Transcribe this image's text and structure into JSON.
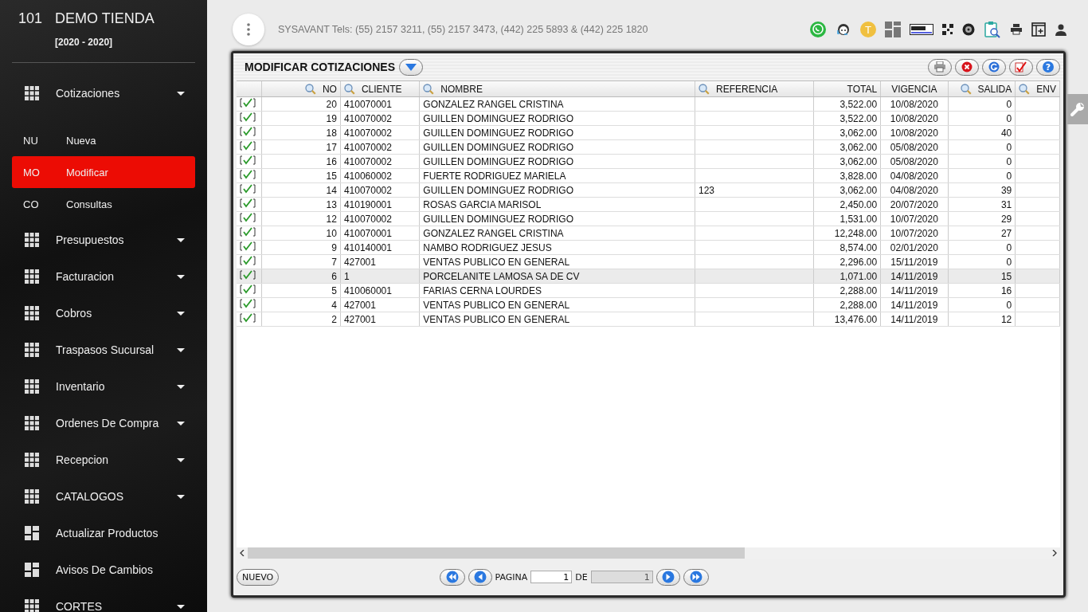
{
  "sidebar": {
    "store_number": "101",
    "store_name": "DEMO TIENDA",
    "period": "[2020 - 2020]",
    "items": [
      {
        "kind": "menu",
        "label": "Cotizaciones",
        "children": [
          {
            "abbr": "NU",
            "label": "Nueva",
            "selected": false
          },
          {
            "abbr": "MO",
            "label": "Modificar",
            "selected": true
          },
          {
            "abbr": "CO",
            "label": "Consultas",
            "selected": false
          }
        ]
      },
      {
        "kind": "menu",
        "label": "Presupuestos"
      },
      {
        "kind": "menu",
        "label": "Facturacion"
      },
      {
        "kind": "menu",
        "label": "Cobros"
      },
      {
        "kind": "menu",
        "label": "Traspasos Sucursal"
      },
      {
        "kind": "menu",
        "label": "Inventario"
      },
      {
        "kind": "menu",
        "label": "Ordenes De Compra"
      },
      {
        "kind": "menu",
        "label": "Recepcion"
      },
      {
        "kind": "menu",
        "label": "CATALOGOS"
      },
      {
        "kind": "link",
        "label": "Actualizar Productos"
      },
      {
        "kind": "link",
        "label": "Avisos De Cambios"
      },
      {
        "kind": "menu",
        "label": "CORTES"
      }
    ]
  },
  "header": {
    "contact": "SYSAVANT Tels: (55) 2157 3211, (55) 2157 3473, (442) 225 5893 & (442) 225 1820",
    "avatar_letter": "T"
  },
  "window": {
    "title": "MODIFICAR COTIZACIONES",
    "help_glyph": "?",
    "columns": [
      {
        "label": "NO",
        "searchable": true
      },
      {
        "label": "CLIENTE",
        "searchable": true
      },
      {
        "label": "NOMBRE",
        "searchable": true
      },
      {
        "label": "REFERENCIA",
        "searchable": true
      },
      {
        "label": "TOTAL",
        "searchable": false
      },
      {
        "label": "VIGENCIA",
        "searchable": false
      },
      {
        "label": "SALIDA",
        "searchable": true
      },
      {
        "label": "ENV",
        "searchable": true
      }
    ],
    "rows": [
      {
        "checked": true,
        "selected": false,
        "cells": [
          "20",
          "410070001",
          "GONZALEZ RANGEL CRISTINA",
          "",
          "3,522.00",
          "10/08/2020",
          "0"
        ]
      },
      {
        "checked": true,
        "selected": false,
        "cells": [
          "19",
          "410070002",
          "GUILLEN DOMINGUEZ RODRIGO",
          "",
          "3,522.00",
          "10/08/2020",
          "0"
        ]
      },
      {
        "checked": true,
        "selected": false,
        "cells": [
          "18",
          "410070002",
          "GUILLEN DOMINGUEZ RODRIGO",
          "",
          "3,062.00",
          "10/08/2020",
          "40"
        ]
      },
      {
        "checked": true,
        "selected": false,
        "cells": [
          "17",
          "410070002",
          "GUILLEN DOMINGUEZ RODRIGO",
          "",
          "3,062.00",
          "05/08/2020",
          "0"
        ]
      },
      {
        "checked": true,
        "selected": false,
        "cells": [
          "16",
          "410070002",
          "GUILLEN DOMINGUEZ RODRIGO",
          "",
          "3,062.00",
          "05/08/2020",
          "0"
        ]
      },
      {
        "checked": true,
        "selected": false,
        "cells": [
          "15",
          "410060002",
          "FUERTE RODRIGUEZ MARIELA",
          "",
          "3,828.00",
          "04/08/2020",
          "0"
        ]
      },
      {
        "checked": true,
        "selected": false,
        "cells": [
          "14",
          "410070002",
          "GUILLEN DOMINGUEZ RODRIGO",
          "123",
          "3,062.00",
          "04/08/2020",
          "39"
        ]
      },
      {
        "checked": true,
        "selected": false,
        "cells": [
          "13",
          "410190001",
          "ROSAS GARCIA MARISOL",
          "",
          "2,450.00",
          "20/07/2020",
          "31"
        ]
      },
      {
        "checked": true,
        "selected": false,
        "cells": [
          "12",
          "410070002",
          "GUILLEN DOMINGUEZ RODRIGO",
          "",
          "1,531.00",
          "10/07/2020",
          "29"
        ]
      },
      {
        "checked": true,
        "selected": false,
        "cells": [
          "10",
          "410070001",
          "GONZALEZ RANGEL CRISTINA",
          "",
          "12,248.00",
          "10/07/2020",
          "27"
        ]
      },
      {
        "checked": true,
        "selected": false,
        "cells": [
          "9",
          "410140001",
          "NAMBO RODRIGUEZ JESUS",
          "",
          "8,574.00",
          "02/01/2020",
          "0"
        ]
      },
      {
        "checked": true,
        "selected": false,
        "cells": [
          "7",
          "427001",
          "VENTAS PUBLICO EN GENERAL",
          "",
          "2,296.00",
          "15/11/2019",
          "0"
        ]
      },
      {
        "checked": true,
        "selected": true,
        "cells": [
          "6",
          "1",
          "PORCELANITE LAMOSA SA DE CV",
          "",
          "1,071.00",
          "14/11/2019",
          "15"
        ]
      },
      {
        "checked": true,
        "selected": false,
        "cells": [
          "5",
          "410060001",
          "FARIAS CERNA LOURDES",
          "",
          "2,288.00",
          "14/11/2019",
          "16"
        ]
      },
      {
        "checked": true,
        "selected": false,
        "cells": [
          "4",
          "427001",
          "VENTAS PUBLICO EN GENERAL",
          "",
          "2,288.00",
          "14/11/2019",
          "0"
        ]
      },
      {
        "checked": true,
        "selected": false,
        "cells": [
          "2",
          "427001",
          "VENTAS PUBLICO EN GENERAL",
          "",
          "13,476.00",
          "14/11/2019",
          "12"
        ]
      }
    ],
    "new_button": "NUEVO",
    "pager": {
      "label": "PAGINA",
      "page": "1",
      "of_label": "DE",
      "total": "1"
    }
  }
}
